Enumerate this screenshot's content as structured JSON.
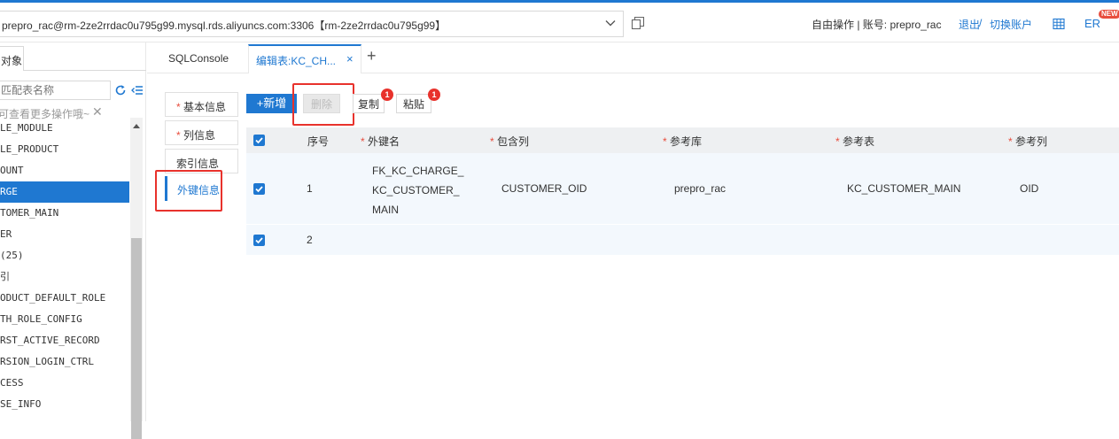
{
  "topbar": {
    "connection": "prepro_rac@rm-2ze2rrdac0u795g99.mysql.rds.aliyuncs.com:3306【rm-2ze2rrdac0u795g99】",
    "mode_account": "自由操作 | 账号: prepro_rac",
    "logout": "退出",
    "sep": " / ",
    "switch_account": "切换账户",
    "er_label": "ER",
    "new_badge": "NEW"
  },
  "left": {
    "objects_tab": "对象",
    "filter_placeholder": "匹配表名称",
    "tip": "可查看更多操作哦~",
    "tip_close": "✕",
    "tables": [
      "LE_MODULE",
      "LE_PRODUCT",
      "OUNT",
      "RGE",
      "TOMER_MAIN",
      "ER",
      "(25)",
      "引",
      "ODUCT_DEFAULT_ROLE",
      "TH_ROLE_CONFIG",
      "RST_ACTIVE_RECORD",
      "RSION_LOGIN_CTRL",
      "CESS",
      "SE_INFO"
    ],
    "selected_index": 3
  },
  "tabs": {
    "sqlconsole": "SQLConsole",
    "edit_table": "编辑表:KC_CH...",
    "close": "×",
    "add": "+"
  },
  "sidenav": {
    "items": [
      {
        "label": "基本信息",
        "required": "*"
      },
      {
        "label": "列信息",
        "required": "*"
      },
      {
        "label": "索引信息",
        "required": ""
      },
      {
        "label": "外键信息",
        "required": ""
      }
    ]
  },
  "toolbar": {
    "add": "+新增",
    "delete": "删除",
    "copy": "复制",
    "paste": "粘贴",
    "copy_badge": "1",
    "paste_badge": "1"
  },
  "table": {
    "headers": {
      "seq": "序号",
      "fk_name": "外键名",
      "include_col": "包含列",
      "ref_db": "参考库",
      "ref_table": "参考表",
      "ref_col": "参考列"
    },
    "required_mark": "*",
    "rows": [
      {
        "seq": "1",
        "fk_name_lines": [
          "FK_KC_CHARGE_",
          "KC_CUSTOMER_",
          "MAIN"
        ],
        "include_col": "CUSTOMER_OID",
        "ref_db": "prepro_rac",
        "ref_table": "KC_CUSTOMER_MAIN",
        "ref_col": "OID"
      },
      {
        "seq": "2",
        "fk_name_lines": [
          "",
          "",
          ""
        ],
        "include_col": "",
        "ref_db": "",
        "ref_table": "",
        "ref_col": ""
      }
    ]
  },
  "colors": {
    "accent": "#1f78d1",
    "highlight": "#e8322c",
    "row_bg": "#f3f8fd"
  }
}
